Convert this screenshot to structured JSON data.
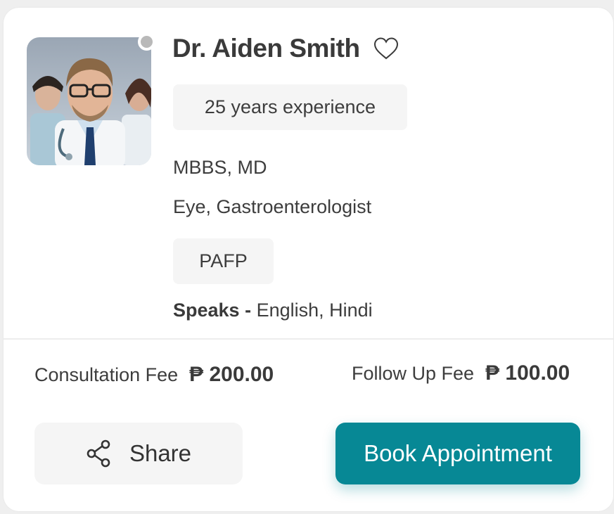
{
  "doctor": {
    "name": "Dr. Aiden Smith",
    "experience": "25 years experience",
    "degree": "MBBS, MD",
    "specialty": "Eye, Gastroenterologist",
    "affiliation": "PAFP",
    "speaks_label": "Speaks -",
    "languages": "English, Hindi",
    "status_color": "#b9b9b9",
    "photo_icon": "doctor-portrait-image"
  },
  "fees": {
    "consultation_label": "Consultation Fee",
    "consultation_amount": "₱ 200.00",
    "followup_label": "Follow Up Fee",
    "followup_amount": "₱ 100.00"
  },
  "actions": {
    "share_label": "Share",
    "share_icon": "share-icon",
    "book_label": "Book Appointment",
    "favorite_icon": "heart-outline-icon"
  },
  "colors": {
    "accent": "#078895",
    "chip_bg": "#f5f5f5",
    "text": "#3b3b3b"
  }
}
